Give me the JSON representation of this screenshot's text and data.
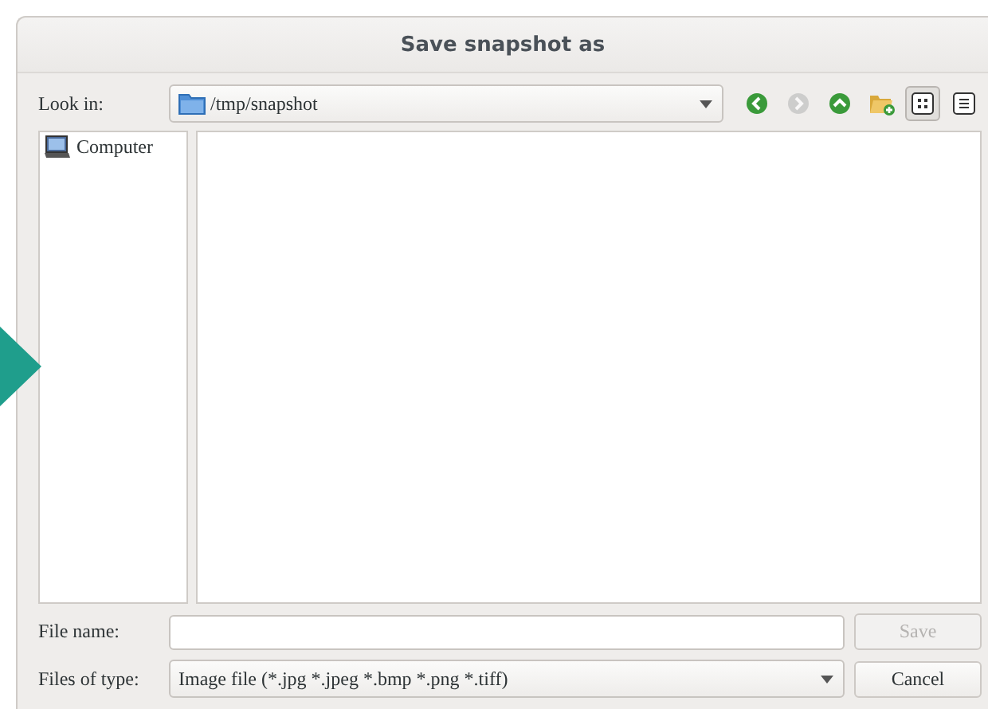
{
  "window": {
    "title": "Save snapshot as"
  },
  "look_in": {
    "label": "Look in:",
    "path": "/tmp/snapshot"
  },
  "toolbar": [
    {
      "kind": "back",
      "disabled": false,
      "selected": false
    },
    {
      "kind": "forward",
      "disabled": true,
      "selected": false
    },
    {
      "kind": "up",
      "disabled": false,
      "selected": false
    },
    {
      "kind": "new-folder",
      "disabled": false,
      "selected": false
    },
    {
      "kind": "icon-view",
      "disabled": false,
      "selected": true
    },
    {
      "kind": "detail-view",
      "disabled": false,
      "selected": false
    }
  ],
  "sidebar": {
    "items": [
      {
        "label": "Computer",
        "selected": false
      }
    ]
  },
  "file_name": {
    "label": "File name:"
  },
  "file_type": {
    "label": "Files of type:",
    "value": "Image file (*.jpg *.jpeg *.bmp *.png *.tiff)"
  },
  "buttons": [
    {
      "label": "Save",
      "disabled": true
    },
    {
      "label": "Cancel",
      "disabled": false
    }
  ]
}
